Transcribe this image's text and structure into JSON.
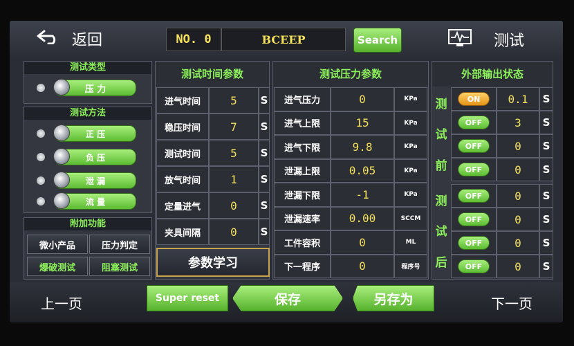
{
  "header": {
    "back_label": "返回",
    "number": "NO. 0",
    "product_name": "BCEEP",
    "search_label": "Search",
    "test_label": "测试"
  },
  "test_type": {
    "title": "测试类型",
    "selected": "压 力"
  },
  "test_method": {
    "title": "测试方法",
    "options": [
      "正 压",
      "负 压",
      "泄 漏",
      "流 量"
    ]
  },
  "extra": {
    "title": "附加功能",
    "buttons": [
      "微小产品",
      "压力判定",
      "爆破测试",
      "阻塞测试"
    ]
  },
  "time_params": {
    "title": "测试时间参数",
    "rows": [
      {
        "label": "进气时间",
        "value": "5",
        "unit": "S"
      },
      {
        "label": "稳压时间",
        "value": "7",
        "unit": "S"
      },
      {
        "label": "测试时间",
        "value": "5",
        "unit": "S"
      },
      {
        "label": "放气时间",
        "value": "1",
        "unit": "S"
      },
      {
        "label": "定量进气",
        "value": "0",
        "unit": "S"
      },
      {
        "label": "夹具间隔",
        "value": "0",
        "unit": "S"
      }
    ],
    "learn_label": "参数学习"
  },
  "pressure_params": {
    "title": "测试压力参数",
    "rows": [
      {
        "label": "进气压力",
        "value": "0",
        "unit": "KPa"
      },
      {
        "label": "进气上限",
        "value": "15",
        "unit": "KPa"
      },
      {
        "label": "进气下限",
        "value": "9.8",
        "unit": "KPa"
      },
      {
        "label": "泄漏上限",
        "value": "0.05",
        "unit": "KPa"
      },
      {
        "label": "泄漏下限",
        "value": "-1",
        "unit": "KPa"
      },
      {
        "label": "泄漏速率",
        "value": "0.00",
        "unit": "SCCM"
      },
      {
        "label": "工件容积",
        "value": "0",
        "unit": "ML"
      },
      {
        "label": "下一程序",
        "value": "0",
        "unit": "程序号"
      }
    ]
  },
  "output_status": {
    "title": "外部输出状态",
    "before_label": [
      "测",
      "试",
      "前"
    ],
    "after_label": [
      "测",
      "试",
      "后"
    ],
    "before": [
      {
        "state": "ON",
        "value": "0.1",
        "unit": "S"
      },
      {
        "state": "OFF",
        "value": "3",
        "unit": "S"
      },
      {
        "state": "OFF",
        "value": "0",
        "unit": "S"
      },
      {
        "state": "OFF",
        "value": "0",
        "unit": "S"
      }
    ],
    "after": [
      {
        "state": "OFF",
        "value": "0",
        "unit": "S"
      },
      {
        "state": "OFF",
        "value": "0",
        "unit": "S"
      },
      {
        "state": "OFF",
        "value": "0",
        "unit": "S"
      },
      {
        "state": "OFF",
        "value": "0",
        "unit": "S"
      }
    ]
  },
  "footer": {
    "prev_label": "上一页",
    "super_reset_label": "Super reset",
    "save_label": "保存",
    "save_as_label": "另存为",
    "next_label": "下一页"
  }
}
